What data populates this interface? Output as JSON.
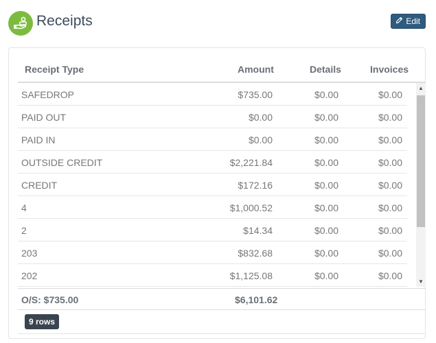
{
  "header": {
    "title": "Receipts",
    "edit_label": "Edit",
    "logo_icon": "hand-money-icon",
    "edit_icon": "pencil-icon",
    "logo_color": "#7dbb3f",
    "edit_color": "#2f5b7f"
  },
  "table": {
    "columns": [
      "Receipt Type",
      "Amount",
      "Details",
      "Invoices"
    ],
    "rows": [
      {
        "type": "SAFEDROP",
        "amount": "$735.00",
        "details": "$0.00",
        "invoices": "$0.00"
      },
      {
        "type": "PAID OUT",
        "amount": "$0.00",
        "details": "$0.00",
        "invoices": "$0.00"
      },
      {
        "type": "PAID IN",
        "amount": "$0.00",
        "details": "$0.00",
        "invoices": "$0.00"
      },
      {
        "type": "OUTSIDE CREDIT",
        "amount": "$2,221.84",
        "details": "$0.00",
        "invoices": "$0.00"
      },
      {
        "type": "CREDIT",
        "amount": "$172.16",
        "details": "$0.00",
        "invoices": "$0.00"
      },
      {
        "type": "4",
        "amount": "$1,000.52",
        "details": "$0.00",
        "invoices": "$0.00"
      },
      {
        "type": "2",
        "amount": "$14.34",
        "details": "$0.00",
        "invoices": "$0.00"
      },
      {
        "type": "203",
        "amount": "$832.68",
        "details": "$0.00",
        "invoices": "$0.00"
      },
      {
        "type": "202",
        "amount": "$1,125.08",
        "details": "$0.00",
        "invoices": "$0.00"
      }
    ],
    "footer": {
      "os": "O/S: $735.00",
      "total": "$6,101.62"
    },
    "rows_badge": "9 rows"
  }
}
